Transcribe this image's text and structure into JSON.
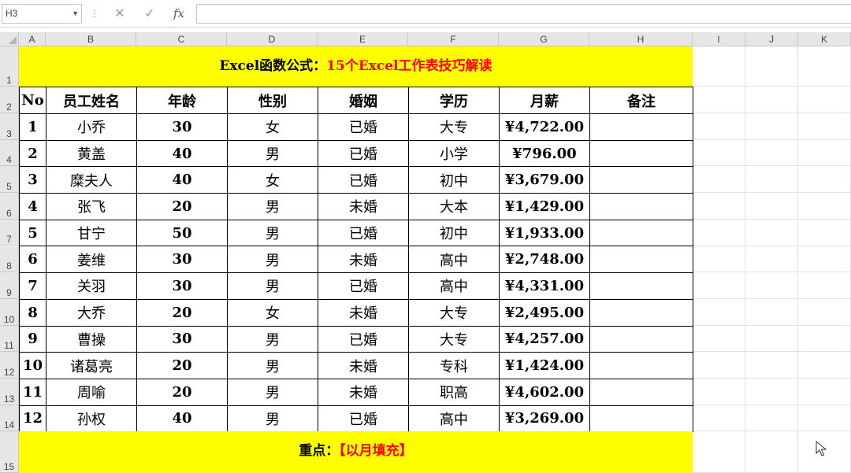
{
  "formula_bar": {
    "name_box": "H3",
    "fx_label": "fx"
  },
  "columns": [
    "A",
    "B",
    "C",
    "D",
    "E",
    "F",
    "G",
    "H",
    "I",
    "J",
    "K"
  ],
  "rows": [
    "1",
    "2",
    "3",
    "4",
    "5",
    "6",
    "7",
    "8",
    "9",
    "10",
    "11",
    "12",
    "13",
    "14",
    "15"
  ],
  "title": {
    "part1": "Excel函数公式：",
    "part2": "15个Excel工作表技巧解读"
  },
  "table": {
    "headers": [
      "No",
      "员工姓名",
      "年龄",
      "性别",
      "婚姻",
      "学历",
      "月薪",
      "备注"
    ],
    "rows": [
      [
        "1",
        "小乔",
        "30",
        "女",
        "已婚",
        "大专",
        "¥4,722.00",
        ""
      ],
      [
        "2",
        "黄盖",
        "40",
        "男",
        "已婚",
        "小学",
        "¥796.00",
        ""
      ],
      [
        "3",
        "糜夫人",
        "40",
        "女",
        "已婚",
        "初中",
        "¥3,679.00",
        ""
      ],
      [
        "4",
        "张飞",
        "20",
        "男",
        "未婚",
        "大本",
        "¥1,429.00",
        ""
      ],
      [
        "5",
        "甘宁",
        "50",
        "男",
        "已婚",
        "初中",
        "¥1,933.00",
        ""
      ],
      [
        "6",
        "姜维",
        "30",
        "男",
        "未婚",
        "高中",
        "¥2,748.00",
        ""
      ],
      [
        "7",
        "关羽",
        "30",
        "男",
        "已婚",
        "高中",
        "¥4,331.00",
        ""
      ],
      [
        "8",
        "大乔",
        "20",
        "女",
        "未婚",
        "大专",
        "¥2,495.00",
        ""
      ],
      [
        "9",
        "曹操",
        "30",
        "男",
        "已婚",
        "大专",
        "¥4,257.00",
        ""
      ],
      [
        "10",
        "诸葛亮",
        "20",
        "男",
        "未婚",
        "专科",
        "¥1,424.00",
        ""
      ],
      [
        "11",
        "周喻",
        "20",
        "男",
        "未婚",
        "职高",
        "¥4,602.00",
        ""
      ],
      [
        "12",
        "孙权",
        "40",
        "男",
        "已婚",
        "高中",
        "¥3,269.00",
        ""
      ]
    ]
  },
  "footer": {
    "part1": "重点：",
    "part2": "【以月填充】"
  },
  "colors": {
    "banner": "#ffff00",
    "accent_red": "#ff0000"
  }
}
